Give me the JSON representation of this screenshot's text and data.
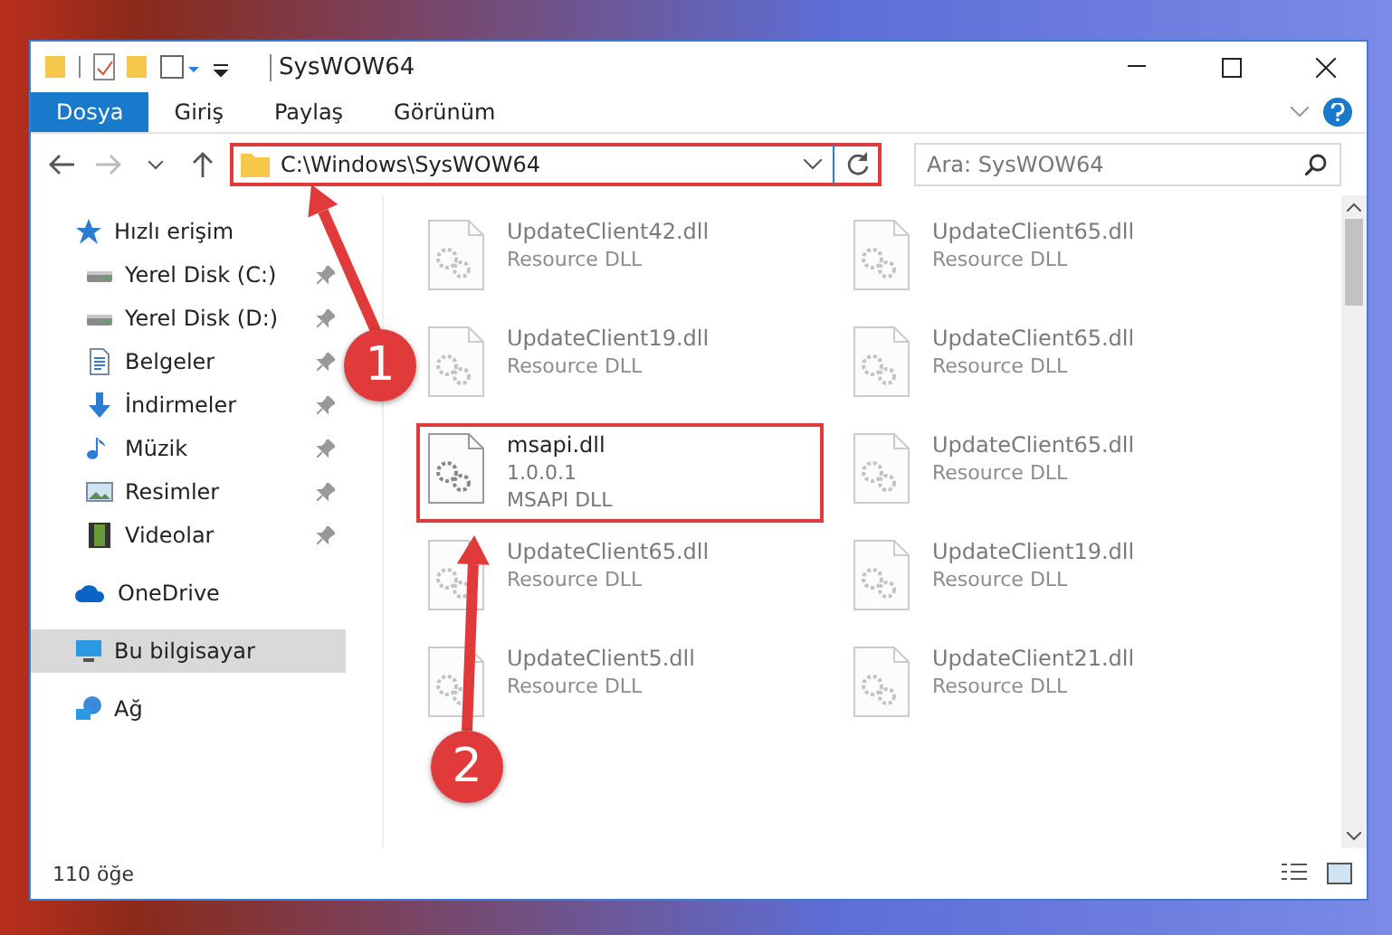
{
  "window": {
    "title": "SysWOW64"
  },
  "ribbon_tabs": [
    {
      "label": "Dosya",
      "selected": true
    },
    {
      "label": "Giriş",
      "selected": false
    },
    {
      "label": "Paylaş",
      "selected": false
    },
    {
      "label": "Görünüm",
      "selected": false
    }
  ],
  "address_bar": {
    "path": "C:\\Windows\\SysWOW64",
    "highlighted": true
  },
  "search": {
    "placeholder": "Ara: SysWOW64"
  },
  "sidebar": {
    "groups": [
      {
        "label": "Hızlı erişim",
        "kind": "star",
        "selected": false,
        "children": [
          {
            "label": "Yerel Disk (C:)",
            "kind": "drive",
            "pinned": true,
            "selected": false
          },
          {
            "label": "Yerel Disk (D:)",
            "kind": "drive",
            "pinned": true,
            "selected": false
          },
          {
            "label": "Belgeler",
            "kind": "document",
            "pinned": true,
            "selected": false
          },
          {
            "label": "İndirmeler",
            "kind": "download",
            "pinned": true,
            "selected": false
          },
          {
            "label": "Müzik",
            "kind": "music",
            "pinned": true,
            "selected": false
          },
          {
            "label": "Resimler",
            "kind": "pictures",
            "pinned": true,
            "selected": false
          },
          {
            "label": "Videolar",
            "kind": "video",
            "pinned": true,
            "selected": false
          }
        ]
      },
      {
        "label": "OneDrive",
        "kind": "cloud",
        "selected": false
      },
      {
        "label": "Bu bilgisayar",
        "kind": "computer",
        "selected": true
      },
      {
        "label": "Ağ",
        "kind": "network",
        "selected": false
      }
    ]
  },
  "files": [
    {
      "name": "UpdateClient42.dll",
      "lines": [
        "Resource DLL"
      ],
      "dimmed": true,
      "highlighted": false
    },
    {
      "name": "UpdateClient65.dll",
      "lines": [
        "Resource DLL"
      ],
      "dimmed": true,
      "highlighted": false
    },
    {
      "name": "UpdateClient19.dll",
      "lines": [
        "Resource DLL"
      ],
      "dimmed": true,
      "highlighted": false
    },
    {
      "name": "UpdateClient65.dll",
      "lines": [
        "Resource DLL"
      ],
      "dimmed": true,
      "highlighted": false
    },
    {
      "name": "msapi.dll",
      "lines": [
        "1.0.0.1",
        "MSAPI DLL"
      ],
      "dimmed": false,
      "highlighted": true
    },
    {
      "name": "UpdateClient65.dll",
      "lines": [
        "Resource DLL"
      ],
      "dimmed": true,
      "highlighted": false
    },
    {
      "name": "UpdateClient65.dll",
      "lines": [
        "Resource DLL"
      ],
      "dimmed": true,
      "highlighted": false
    },
    {
      "name": "UpdateClient19.dll",
      "lines": [
        "Resource DLL"
      ],
      "dimmed": true,
      "highlighted": false
    },
    {
      "name": "UpdateClient5.dll",
      "lines": [
        "Resource DLL"
      ],
      "dimmed": true,
      "highlighted": false
    },
    {
      "name": "UpdateClient21.dll",
      "lines": [
        "Resource DLL"
      ],
      "dimmed": true,
      "highlighted": false
    }
  ],
  "annotations": [
    {
      "number": "1"
    },
    {
      "number": "2"
    }
  ],
  "status_bar": {
    "count": "110 öğe"
  }
}
